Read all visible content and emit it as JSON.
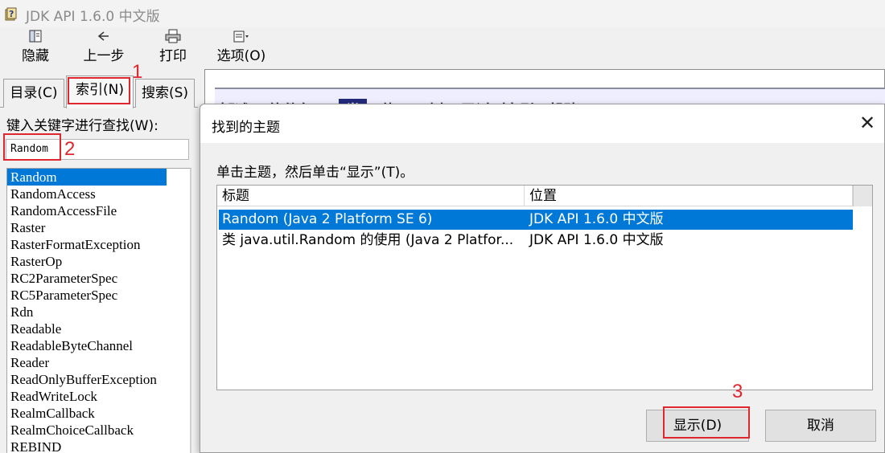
{
  "window": {
    "title": "JDK API 1.6.0 中文版"
  },
  "toolbar": {
    "hide": {
      "label": "隐藏",
      "icon": "hide-pane-icon"
    },
    "back": {
      "label": "上一步",
      "icon": "back-arrow-icon"
    },
    "print": {
      "label": "打印",
      "icon": "printer-icon"
    },
    "options": {
      "label": "选项(O)",
      "icon": "options-icon"
    }
  },
  "tabs": [
    {
      "label": "目录(C)"
    },
    {
      "label": "索引(N)",
      "active": true
    },
    {
      "label": "搜索(S)"
    }
  ],
  "index": {
    "keyword_label": "键入关键字进行查找(W):",
    "keyword_value": "Random",
    "items": [
      "Random",
      "RandomAccess",
      "RandomAccessFile",
      "Raster",
      "RasterFormatException",
      "RasterOp",
      "RC2ParameterSpec",
      "RC5ParameterSpec",
      "Rdn",
      "Readable",
      "ReadableByteChannel",
      "Reader",
      "ReadOnlyBufferException",
      "ReadWriteLock",
      "RealmCallback",
      "RealmChoiceCallback",
      "REBIND"
    ],
    "selected_index": 0
  },
  "background_nav": [
    "概述",
    "软件包",
    "类",
    "使用",
    "树",
    "已过时",
    "索引",
    "帮助"
  ],
  "dialog": {
    "title": "找到的主题",
    "instruction": "单击主题，然后单击“显示”(T)。",
    "columns": [
      "标题",
      "位置"
    ],
    "rows": [
      {
        "title": "Random (Java 2 Platform SE 6)",
        "location": "JDK API 1.6.0 中文版",
        "selected": true
      },
      {
        "title": "类 java.util.Random 的使用 (Java 2 Platfor...",
        "location": "JDK API 1.6.0 中文版",
        "selected": false
      }
    ],
    "display_button": "显示(D)",
    "cancel_button": "取消"
  },
  "annotations": [
    "1",
    "2",
    "3"
  ],
  "colors": {
    "selection": "#0078d7",
    "annotation_red": "#e0262e"
  }
}
